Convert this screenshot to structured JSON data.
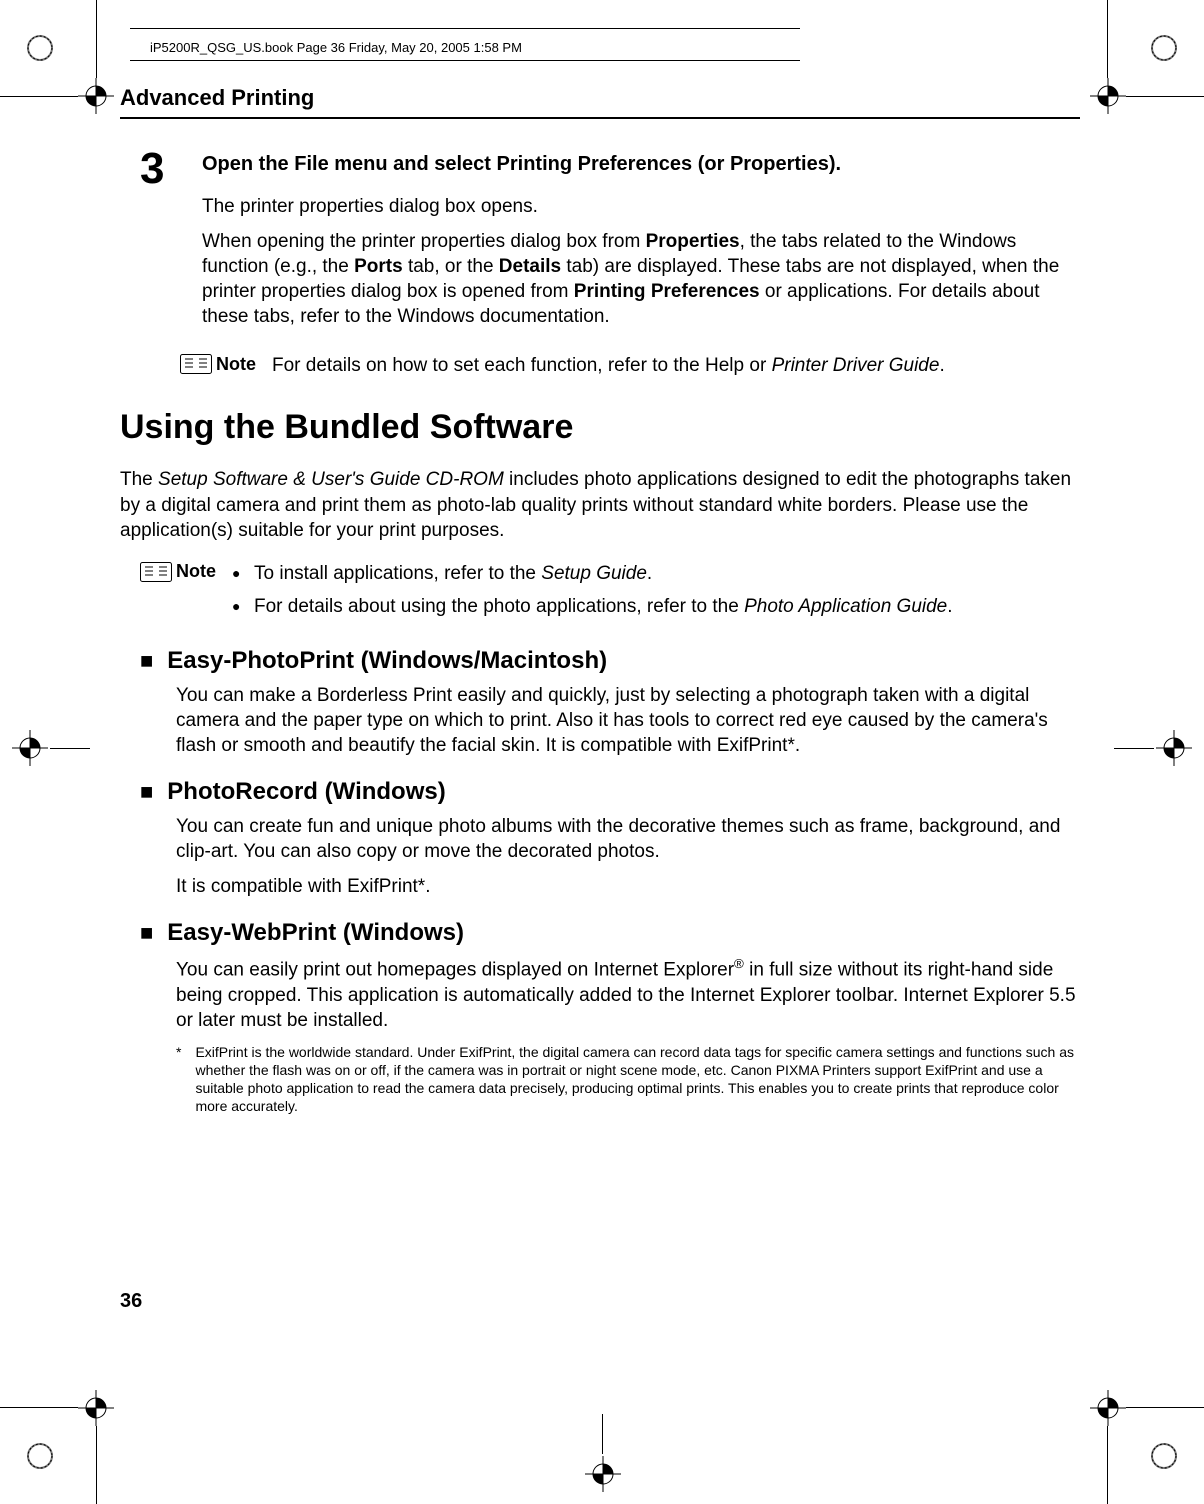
{
  "running_header": "iP5200R_QSG_US.book  Page 36  Friday, May 20, 2005  1:58 PM",
  "section_header": "Advanced Printing",
  "step3": {
    "num": "3",
    "title_parts": {
      "pre": "Open the ",
      "file": "File",
      "mid1": " menu and select ",
      "pp": "Printing Preferences",
      "mid2": " (or ",
      "props": "Properties",
      "end": ")."
    },
    "p1": "The printer properties dialog box opens.",
    "p2_parts": {
      "a": "When opening the printer properties dialog box from ",
      "b": "Properties",
      "c": ", the tabs related to the Windows function (e.g., the ",
      "d": "Ports",
      "e": " tab, or the ",
      "f": "Details",
      "g": " tab) are displayed. These tabs are not displayed, when the printer properties dialog box is opened from ",
      "h": "Printing Preferences",
      "i": " or applications. For details about these tabs, refer to the Windows documentation."
    },
    "note_label": "Note",
    "note_parts": {
      "a": "For details on how to set each function, refer to the Help or ",
      "b": "Printer Driver Guide",
      "c": "."
    }
  },
  "h1": "Using the Bundled Software",
  "intro_parts": {
    "a": "The ",
    "b": "Setup Software & User's Guide CD-ROM",
    "c": " includes photo applications designed to edit the photographs taken by a digital camera and print them as photo-lab quality prints without standard white borders. Please use the application(s) suitable for your print purposes."
  },
  "note2": {
    "label": "Note",
    "b1a": "To install applications, refer to the ",
    "b1b": "Setup Guide",
    "b1c": ".",
    "b2a": "For details about using the photo applications, refer to the ",
    "b2b": "Photo Application Guide",
    "b2c": "."
  },
  "sub1": {
    "title": "Easy-PhotoPrint (Windows/Macintosh)",
    "body": "You can make a Borderless Print easily and quickly, just by selecting a photograph taken with a digital camera and the paper type on which to print. Also it has tools to correct red eye caused by the camera's flash or smooth and beautify the facial skin. It is compatible with ExifPrint*."
  },
  "sub2": {
    "title": "PhotoRecord (Windows)",
    "p1": "You can create fun and unique photo albums with the decorative themes such as frame, background, and clip-art. You can also copy or move the decorated photos.",
    "p2": "It is compatible with ExifPrint*."
  },
  "sub3": {
    "title": "Easy-WebPrint (Windows)",
    "body_a": "You can easily print out homepages displayed on Internet Explorer",
    "body_b": " in full size without its right-hand side being cropped. This application is automatically added to the Internet Explorer toolbar. Internet Explorer 5.5 or later must be installed."
  },
  "footnote": {
    "star": "*",
    "text": "ExifPrint is the worldwide standard. Under ExifPrint, the digital camera can record data tags for specific camera settings and functions such as whether the flash was on or off, if the camera was in portrait or night scene mode, etc. Canon PIXMA Printers support ExifPrint and use a suitable photo application to read the camera data precisely, producing optimal prints. This enables you to create prints that reproduce color more accurately."
  },
  "page_number": "36"
}
